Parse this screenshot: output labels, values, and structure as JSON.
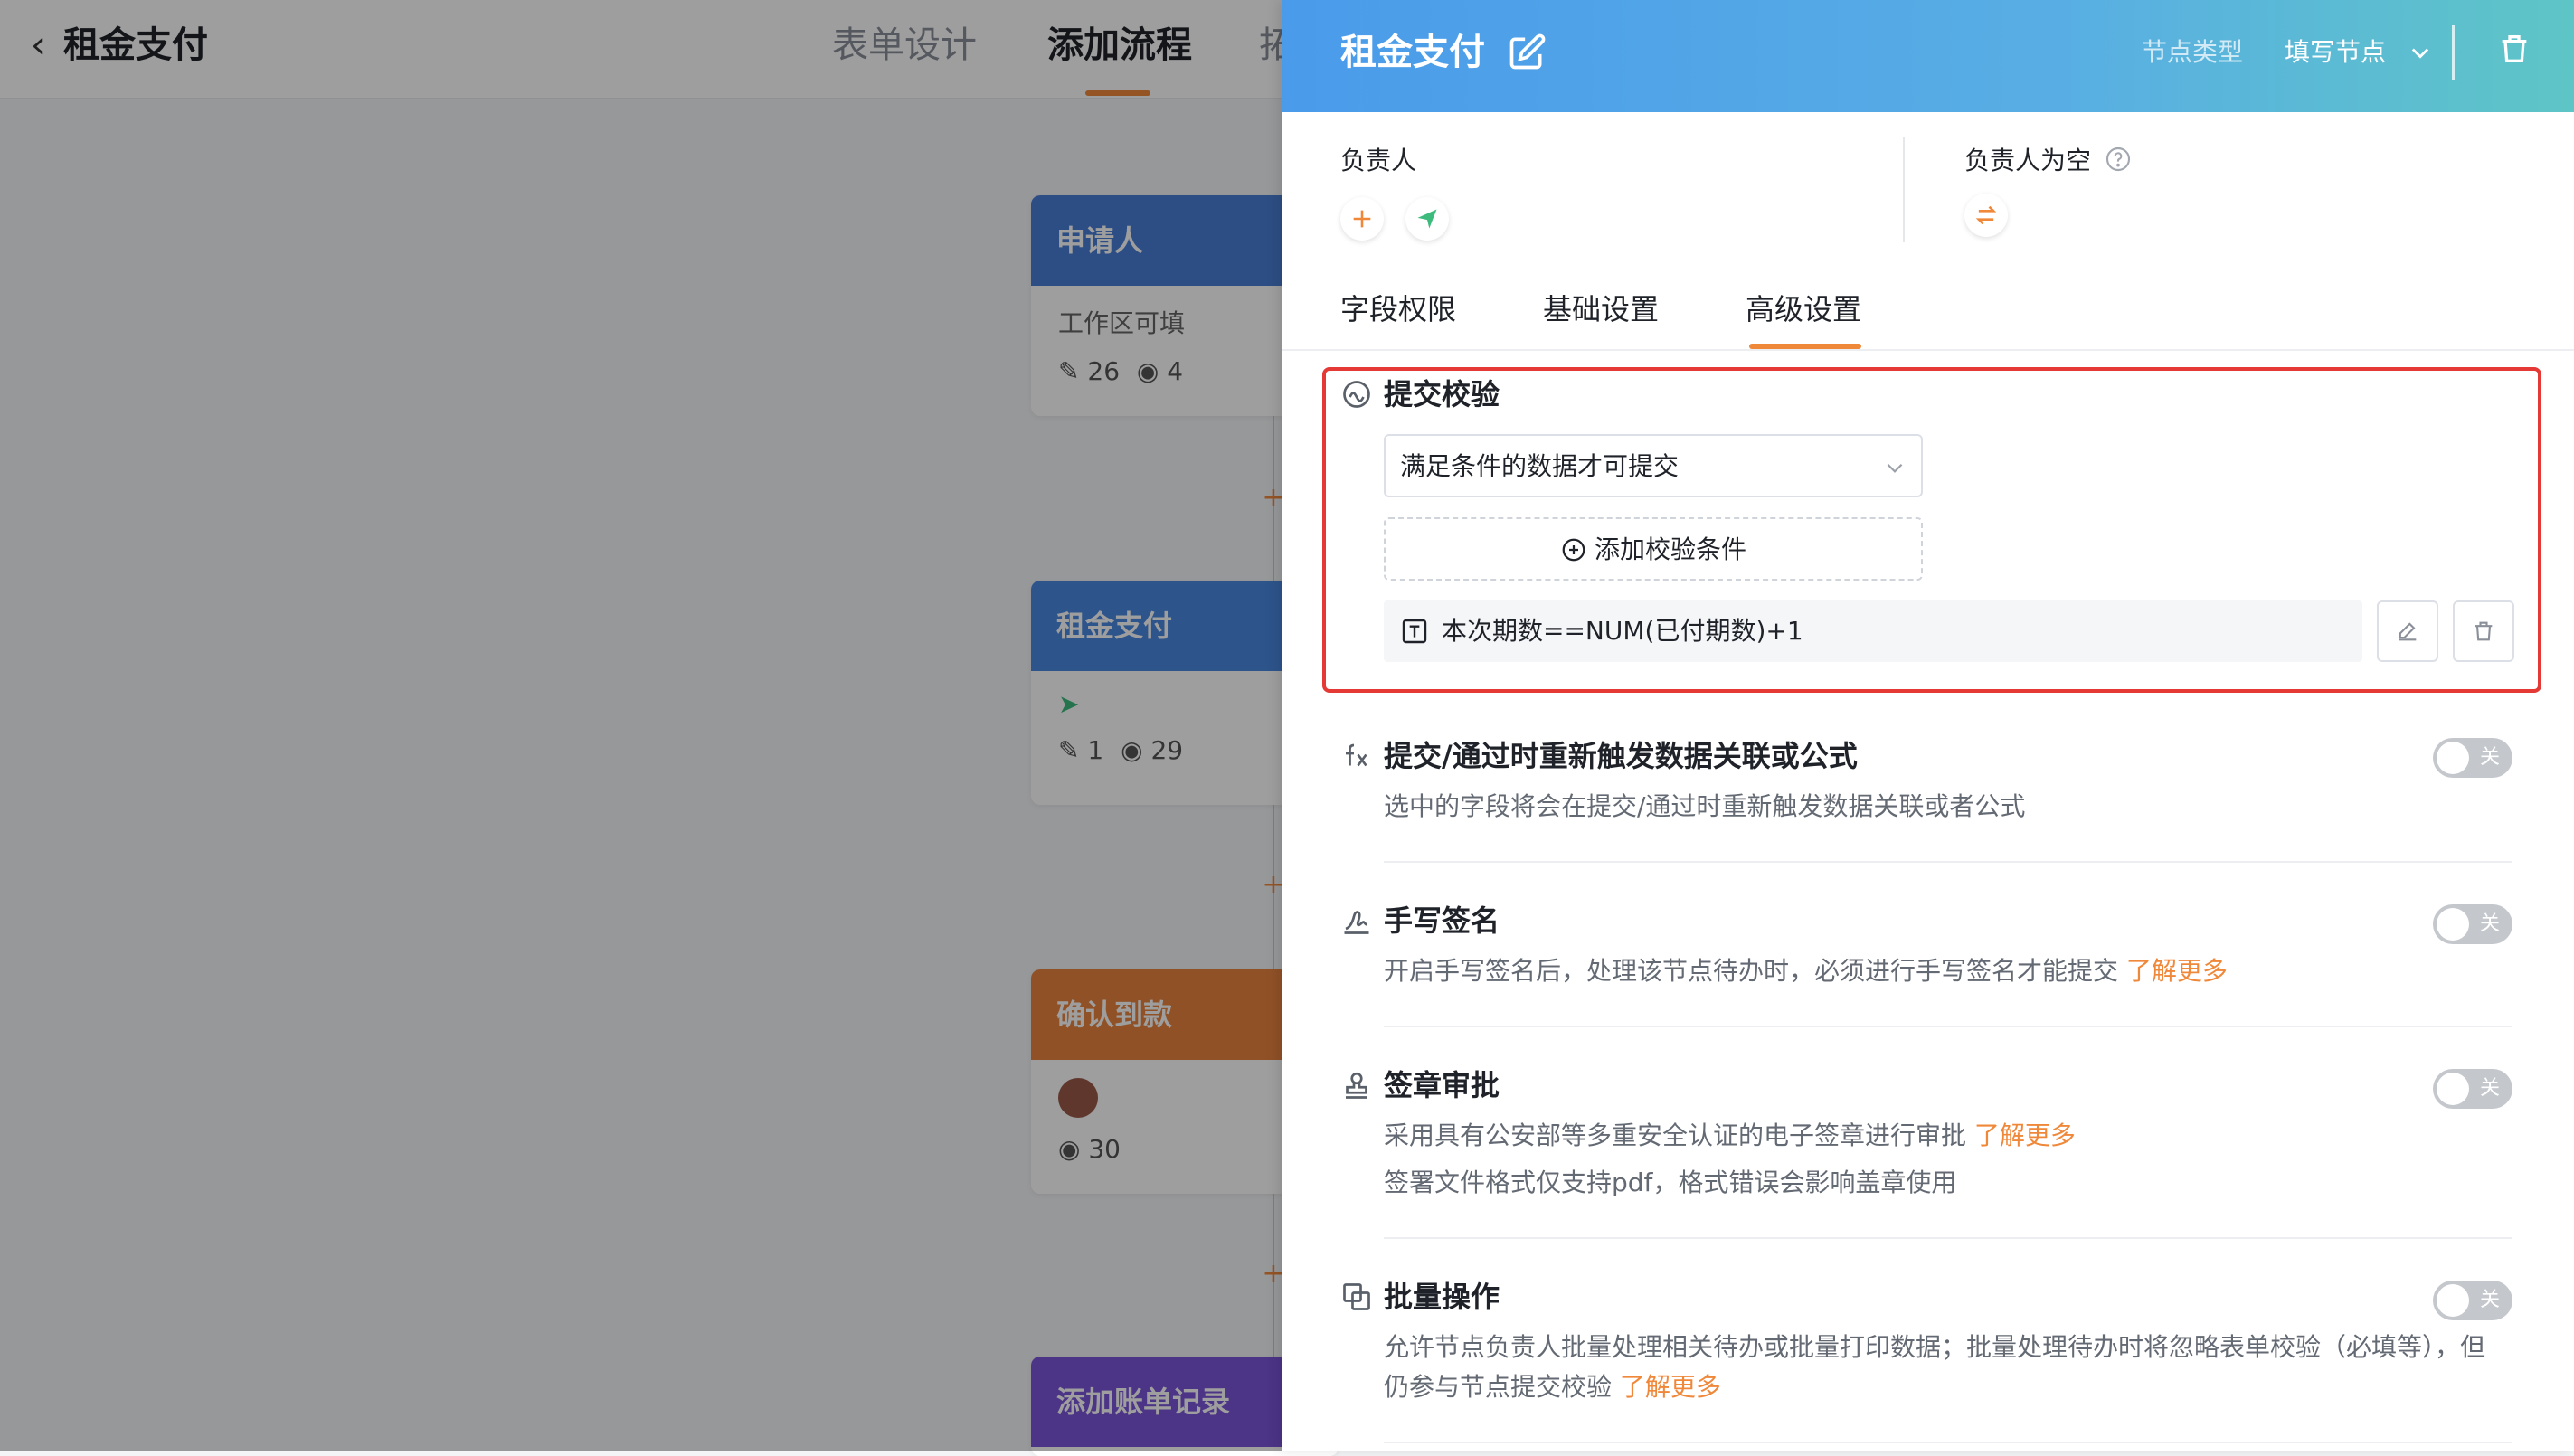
{
  "app": {
    "title": "租金支付",
    "tabs": [
      "表单设计",
      "添加流程",
      "拓"
    ],
    "active_tab": "添加流程"
  },
  "flow": {
    "nodes": [
      {
        "title": "申请人",
        "color": "#4a7fd6",
        "line": "工作区可填",
        "edit_count": "26",
        "view_count": "4"
      },
      {
        "title": "租金支付",
        "color": "#4a88e0",
        "edit_count": "1",
        "view_count": "29"
      },
      {
        "title": "确认到款",
        "color": "#e8843f",
        "view_count": "30"
      },
      {
        "title": "添加账单记录",
        "color": "#7b55d9"
      }
    ]
  },
  "drawer": {
    "title": "租金支付",
    "node_type_label": "节点类型",
    "node_type_value": "填写节点",
    "owner": {
      "label": "负责人"
    },
    "owner_empty": {
      "label": "负责人为空"
    },
    "tabs": [
      "字段权限",
      "基础设置",
      "高级设置"
    ],
    "active_tab": "高级设置",
    "submit_check": {
      "title": "提交校验",
      "select_value": "满足条件的数据才可提交",
      "add_label": "添加校验条件",
      "condition": "本次期数==NUM(已付期数)+1"
    },
    "sections": [
      {
        "icon": "fx-icon",
        "title": "提交/通过时重新触发数据关联或公式",
        "desc": "选中的字段将会在提交/通过时重新触发数据关联或者公式",
        "toggle": "关"
      },
      {
        "icon": "signature-icon",
        "title": "手写签名",
        "desc": "开启手写签名后，处理该节点待办时，必须进行手写签名才能提交",
        "link": "了解更多",
        "toggle": "关"
      },
      {
        "icon": "stamp-icon",
        "title": "签章审批",
        "desc": "采用具有公安部等多重安全认证的电子签章进行审批",
        "link": "了解更多",
        "desc2": "签署文件格式仅支持pdf，格式错误会影响盖章使用",
        "toggle": "关"
      },
      {
        "icon": "batch-icon",
        "title": "批量操作",
        "desc": "允许节点负责人批量处理相关待办或批量打印数据；批量处理待办时将忽略表单校验（必填等），但",
        "desc2": "仍参与节点提交校验",
        "link": "了解更多",
        "toggle": "关"
      }
    ],
    "colors": {
      "accent": "#f0883a",
      "highlight": "#e53935",
      "header_start": "#4a9bea",
      "header_end": "#5ec5c6"
    }
  }
}
